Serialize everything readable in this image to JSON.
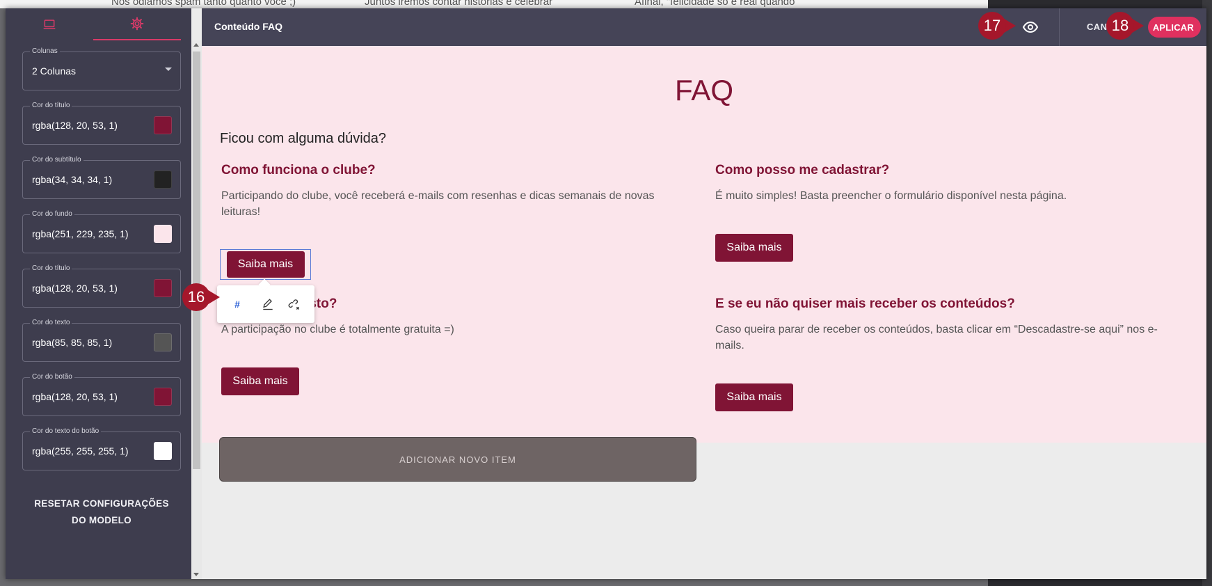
{
  "background": {
    "texts": [
      "Nos odiamos spam tanto quanto você ;)",
      "Juntos iremos contar histórias e celebrar",
      "Afinal, \"felicidade só é real quando"
    ]
  },
  "sidebar": {
    "fields": [
      {
        "label": "Colunas",
        "value": "2 Colunas",
        "type": "select"
      },
      {
        "label": "Cor do título",
        "value": "rgba(128, 20, 53, 1)",
        "color": "#801435"
      },
      {
        "label": "Cor do subtítulo",
        "value": "rgba(34, 34, 34, 1)",
        "color": "#222222"
      },
      {
        "label": "Cor do fundo",
        "value": "rgba(251, 229, 235, 1)",
        "color": "#fbe5eb"
      },
      {
        "label": "Cor do título",
        "value": "rgba(128, 20, 53, 1)",
        "color": "#801435"
      },
      {
        "label": "Cor do texto",
        "value": "rgba(85, 85, 85, 1)",
        "color": "#555555"
      },
      {
        "label": "Cor do botão",
        "value": "rgba(128, 20, 53, 1)",
        "color": "#801435"
      },
      {
        "label": "Cor do texto do botão",
        "value": "rgba(255, 255, 255, 1)",
        "color": "#ffffff"
      }
    ],
    "reset_label_1": "RESETAR CONFIGURAÇÕES",
    "reset_label_2": "DO MODELO",
    "tab_active_color": "#d83a68"
  },
  "topbar": {
    "title": "Conteúdo FAQ",
    "cancel_label": "CANCELAR",
    "apply_label": "APLICAR"
  },
  "content": {
    "title": "FAQ",
    "subtitle": "Ficou com alguma dúvida?",
    "items": [
      {
        "question": "Como funciona o clube?",
        "answer": "Participando do clube, você receberá e-mails com resenhas e dicas semanais de novas leituras!",
        "button": "Saiba mais"
      },
      {
        "question": "Como posso me cadastrar?",
        "answer": "É muito simples! Basta preencher o formulário disponível nesta página.",
        "button": "Saiba mais"
      },
      {
        "question": "Tem algum custo?",
        "answer": "A participação no clube é totalmente gratuita =)",
        "button": "Saiba mais"
      },
      {
        "question": "E se eu não quiser mais receber os conteúdos?",
        "answer": "Caso queira parar de receber os conteúdos, basta clicar em “Descadastre-se aqui” nos e-mails.",
        "button": "Saiba mais"
      }
    ],
    "add_item_label": "ADICIONAR NOVO ITEM",
    "popover": {
      "link_label": "#"
    }
  },
  "annotations": {
    "a16": "16",
    "a17": "17",
    "a18": "18"
  },
  "colors": {
    "accent": "#801435",
    "apply": "#e0305f",
    "badge": "#a5172b"
  }
}
